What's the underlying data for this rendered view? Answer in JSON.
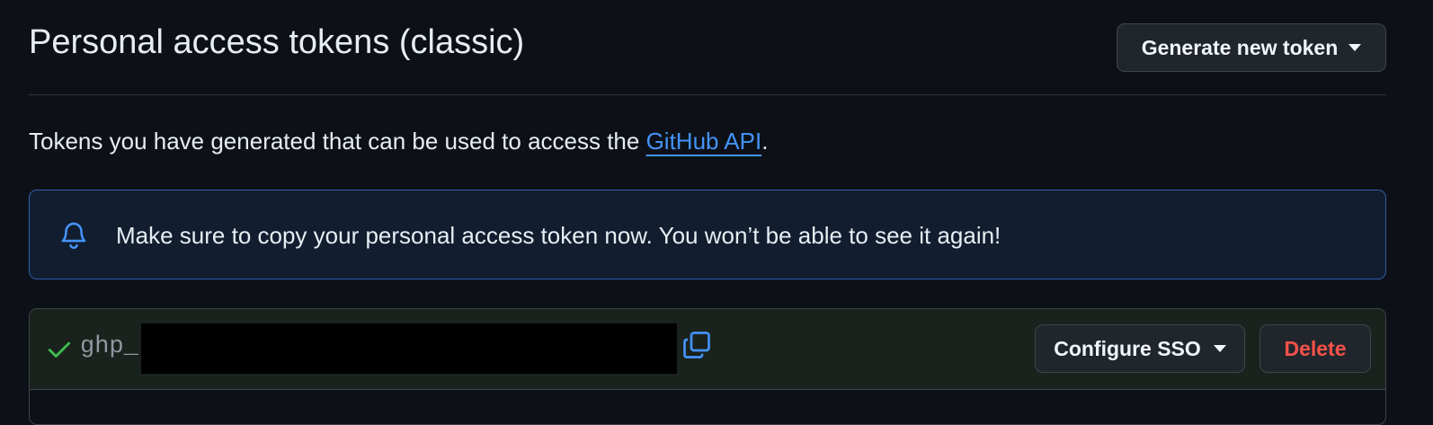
{
  "header": {
    "title": "Personal access tokens (classic)",
    "generate_button_label": "Generate new token"
  },
  "description": {
    "before_link": "Tokens you have generated that can be used to access the ",
    "link_text": "GitHub API",
    "after_link": "."
  },
  "flash": {
    "icon": "bell-icon",
    "message": "Make sure to copy your personal access token now. You won’t be able to see it again!"
  },
  "token": {
    "status_icon": "check-icon",
    "visible_prefix": "ghp_(",
    "copy_icon": "copy-icon",
    "configure_sso_label": "Configure SSO",
    "delete_label": "Delete"
  },
  "colors": {
    "background": "#0d1117",
    "accent_link": "#4493f8",
    "success": "#3fb950",
    "danger": "#f85149",
    "flash_border": "#2f5eb0"
  }
}
